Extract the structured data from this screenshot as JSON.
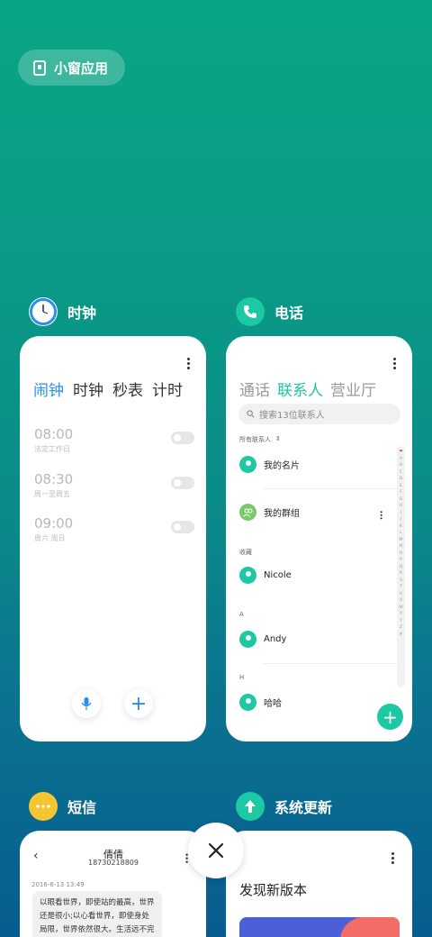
{
  "floating_window": {
    "label": "小窗应用"
  },
  "apps": {
    "clock": {
      "name": "时钟",
      "tabs": [
        "闹钟",
        "时钟",
        "秒表",
        "计时"
      ],
      "alarms": [
        {
          "time": "08:00",
          "repeat": "法定工作日"
        },
        {
          "time": "08:30",
          "repeat": "周一至周五"
        },
        {
          "time": "09:00",
          "repeat": "周六 周日"
        }
      ]
    },
    "phone": {
      "name": "电话",
      "tabs": [
        "通话",
        "联系人",
        "营业厅"
      ],
      "search_placeholder": "搜索13位联系人",
      "filter": "所有联系人",
      "contacts": {
        "my_card": "我的名片",
        "my_groups": "我的群组",
        "fav_label": "收藏",
        "fav": "Nicole",
        "section_a": "A",
        "a1": "Andy",
        "section_h": "H",
        "h1": "哈哈"
      },
      "index": [
        "❤",
        "A",
        "B",
        "C",
        "D",
        "E",
        "F",
        "G",
        "H",
        "I",
        "J",
        "K",
        "L",
        "M",
        "N",
        "O",
        "P",
        "Q",
        "R",
        "S",
        "T",
        "U",
        "V",
        "W",
        "X",
        "Y",
        "Z",
        "#"
      ]
    },
    "sms": {
      "name": "短信",
      "contact_name": "倩倩",
      "contact_number": "18730218809",
      "date": "2016-6-13 13:49",
      "message": "以眼看世界，即使站的最高，世界还是很小;以心看世界，即使身处局限，世界依然很大。生活远不完美，需要用心去体会;无需期盼太多"
    },
    "update": {
      "name": "系统更新",
      "title": "发现新版本"
    }
  },
  "colors": {
    "accent_clock": "#2a8ef0",
    "accent_phone": "#1dc9a2",
    "sms_icon": "#f7c531"
  }
}
